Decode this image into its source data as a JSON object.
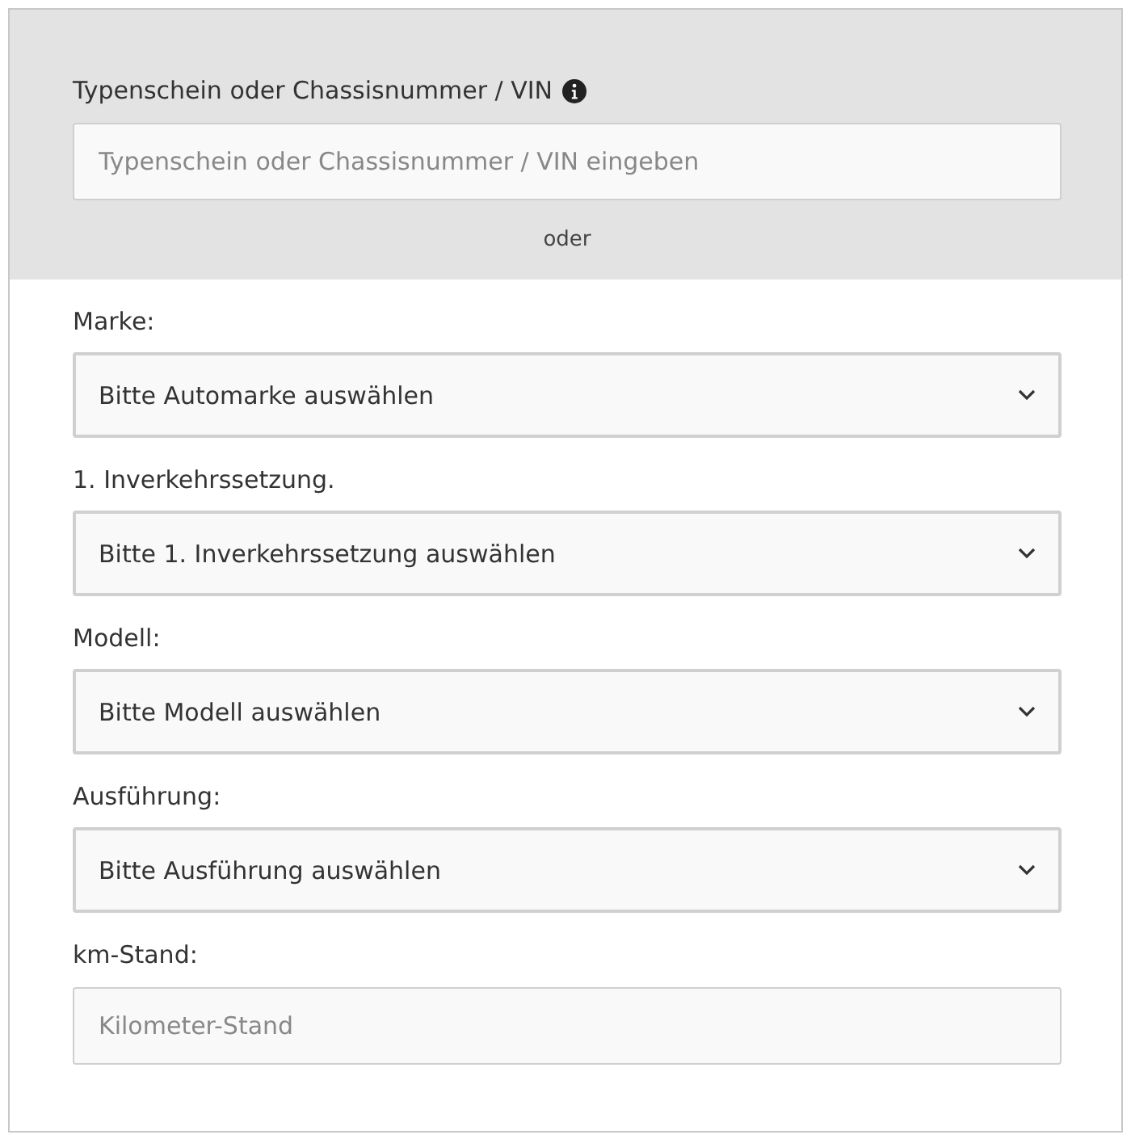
{
  "vin": {
    "label": "Typenschein oder Chassisnummer / VIN",
    "placeholder": "Typenschein oder Chassisnummer / VIN eingeben",
    "separator": "oder"
  },
  "fields": [
    {
      "kind": "select",
      "label": "Marke:",
      "value": "Bitte Automarke auswählen"
    },
    {
      "kind": "select",
      "label": "1. Inverkehrssetzung.",
      "value": "Bitte 1. Inverkehrssetzung auswählen"
    },
    {
      "kind": "select",
      "label": "Modell:",
      "value": "Bitte Modell auswählen"
    },
    {
      "kind": "select",
      "label": "Ausführung:",
      "value": "Bitte Ausführung auswählen"
    },
    {
      "kind": "input",
      "label": "km-Stand:",
      "placeholder": "Kilometer-Stand"
    }
  ]
}
